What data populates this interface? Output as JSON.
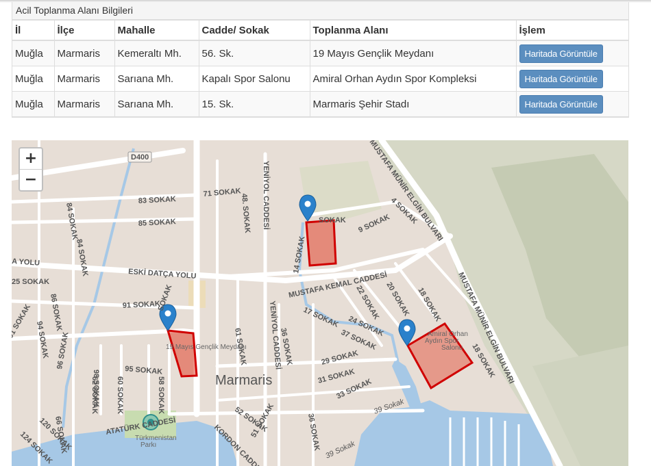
{
  "panel": {
    "title": "Acil Toplanma Alanı Bilgileri"
  },
  "table": {
    "headers": [
      "İl",
      "İlçe",
      "Mahalle",
      "Cadde/ Sokak",
      "Toplanma Alanı",
      "İşlem"
    ],
    "rows": [
      {
        "il": "Muğla",
        "ilce": "Marmaris",
        "mahalle": "Kemeraltı Mh.",
        "cadde": "56. Sk.",
        "alan": "19 Mayıs Gençlik Meydanı",
        "button": "Haritada Görüntüle"
      },
      {
        "il": "Muğla",
        "ilce": "Marmaris",
        "mahalle": "Sarıana Mh.",
        "cadde": "Kapalı Spor Salonu",
        "alan": "Amiral Orhan Aydın Spor Kompleksi",
        "button": "Haritada Görüntüle"
      },
      {
        "il": "Muğla",
        "ilce": "Marmaris",
        "mahalle": "Sarıana Mh.",
        "cadde": "15. Sk.",
        "alan": "Marmaris Şehir Stadı",
        "button": "Haritada Görüntüle"
      }
    ]
  },
  "map": {
    "zoom_in": "+",
    "zoom_out": "−",
    "city_label": "Marmaris",
    "labels": {
      "d400": "D400",
      "s71": "71 SOKAK",
      "s83": "83 SOKAK",
      "s85": "85 SOKAK",
      "s91": "91 SOKAK",
      "s95": "95 SOKAK",
      "s25": "25 SOKAK",
      "s84": "84 SOKAK",
      "s84b": "84 SOKAK",
      "s86": "86 SOKAK",
      "s94": "94 SOKAK",
      "s96": "96 SOKAK",
      "s98": "98 SOKAK",
      "s66": "66 SOKAK",
      "s120": "120 SOKAK",
      "s124": "124 SOKAK",
      "s62": "62 SOKAK",
      "s60": "60 SOKAK",
      "s58": "58 SOKAK",
      "s48": "48. SOKAK",
      "s61": "61 SOKAK",
      "s36": "36 SOKAK",
      "s36b": "36 SOKAK",
      "s52": "52 SOKAK",
      "s51": "51 SOKAK",
      "s29": "29 SOKAK",
      "s31": "31 SOKAK",
      "s33": "33 SOKAK",
      "s39": "39 Sokak",
      "s39b": "39 Sokak",
      "s37": "37 SOKAK",
      "s24": "24 SOKAK",
      "s22": "22 SOKAK",
      "s20": "20 SOKAK",
      "s18": "18 SOKAK",
      "s18b": "18 SOKAK",
      "s17": "17 SOKAK",
      "s14": "14 SOKAK",
      "s9": "9 SOKAK",
      "s4": "4 SOKAK",
      "s91b": "91 SOKAK",
      "sokak": "SOKAK",
      "sokak2": "SOKAK",
      "yolu": "A YOLU",
      "eski_datca": "ESKİ DATÇA YOLU",
      "mustafa_kemal": "MUSTAFA KEMAL CADDESİ",
      "mustafa_munir1": "MUSTAFA MÜNİR ELGİN BULVARI",
      "mustafa_munir2": "MUSTAFA MÜNİR ELGİN BULVARI",
      "yeniyol1": "YENİYOL CADDESİ",
      "yeniyol2": "YENİYOL CADDESİ",
      "kordon": "KORDON CADDESİ",
      "ataturk": "ATATÜRK CADDESİ",
      "gencilik": "19 Mayıs Gençlik Meydanı",
      "spor1": "Amiral Orhan",
      "spor2": "Aydın Spor",
      "spor3": "Salonu",
      "turkmenistan1": "Türkmenistan",
      "turkmenistan2": "Parkı"
    },
    "colors": {
      "highlight_fill": "#e2452f",
      "highlight_stroke": "#d00000",
      "marker": "#2a81cb",
      "water": "#a6c8e6",
      "land": "#e8e0d8"
    }
  }
}
